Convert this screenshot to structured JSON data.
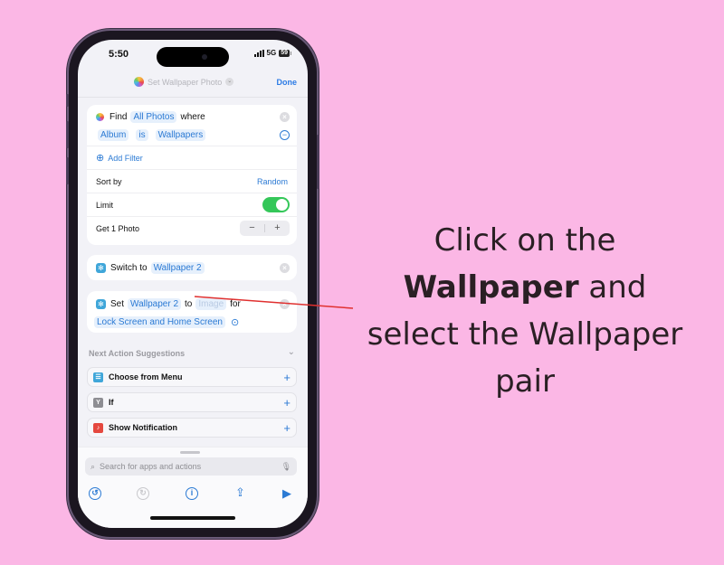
{
  "status_bar": {
    "time": "5:50",
    "network": "5G",
    "battery": "59"
  },
  "header": {
    "title": "Set Wallpaper Photo",
    "done_label": "Done"
  },
  "find_action": {
    "verb": "Find",
    "source": "All Photos",
    "where_label": "where",
    "filter": {
      "field": "Album",
      "operator": "is",
      "value": "Wallpapers"
    },
    "add_filter_label": "Add Filter",
    "sort_by_label": "Sort by",
    "sort_by_value": "Random",
    "limit_label": "Limit",
    "limit_enabled": true,
    "get_label": "Get 1 Photo"
  },
  "switch_action": {
    "verb": "Switch to",
    "value": "Wallpaper 2"
  },
  "set_action": {
    "verb": "Set",
    "wallpaper": "Wallpaper 2",
    "to_label": "to",
    "image_placeholder": "Image",
    "for_label": "for",
    "target": "Lock Screen and Home Screen"
  },
  "suggestions": {
    "title": "Next Action Suggestions",
    "items": [
      {
        "label": "Choose from Menu",
        "icon": "menu-icon",
        "color": "#3fa6d9"
      },
      {
        "label": "If",
        "icon": "branch-icon",
        "color": "#8e8e93"
      },
      {
        "label": "Show Notification",
        "icon": "bell-icon",
        "color": "#e5483f"
      }
    ]
  },
  "search": {
    "placeholder": "Search for apps and actions"
  },
  "instruction": {
    "line1": "Click on the",
    "bold": "Wallpaper",
    "line2_rest": " and",
    "line3": "select the Wallpaper",
    "line4": "pair"
  },
  "colors": {
    "background": "#fbb7e5",
    "accent": "#2b7ad4",
    "toggle_on": "#34c759",
    "pointer_line": "#e0302f"
  }
}
